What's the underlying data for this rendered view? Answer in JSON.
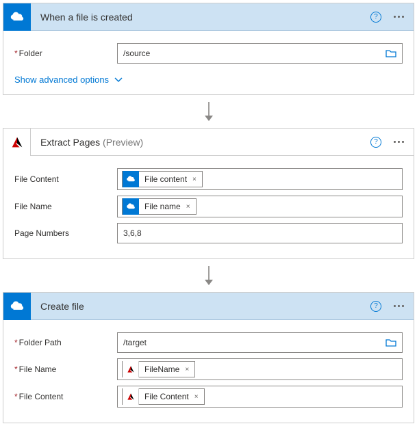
{
  "step1": {
    "title": "When a file is created",
    "folder_label": "Folder",
    "folder_value": "/source",
    "advanced": "Show advanced options"
  },
  "step2": {
    "title": "Extract Pages",
    "preview": "(Preview)",
    "fc_label": "File Content",
    "fc_token": "File content",
    "fn_label": "File Name",
    "fn_token": "File name",
    "pn_label": "Page Numbers",
    "pn_value": "3,6,8"
  },
  "step3": {
    "title": "Create file",
    "fp_label": "Folder Path",
    "fp_value": "/target",
    "fn_label": "File Name",
    "fn_token": "FileName",
    "fc_label": "File Content",
    "fc_token": "File Content"
  },
  "glyph": {
    "x": "×",
    "q": "?"
  }
}
